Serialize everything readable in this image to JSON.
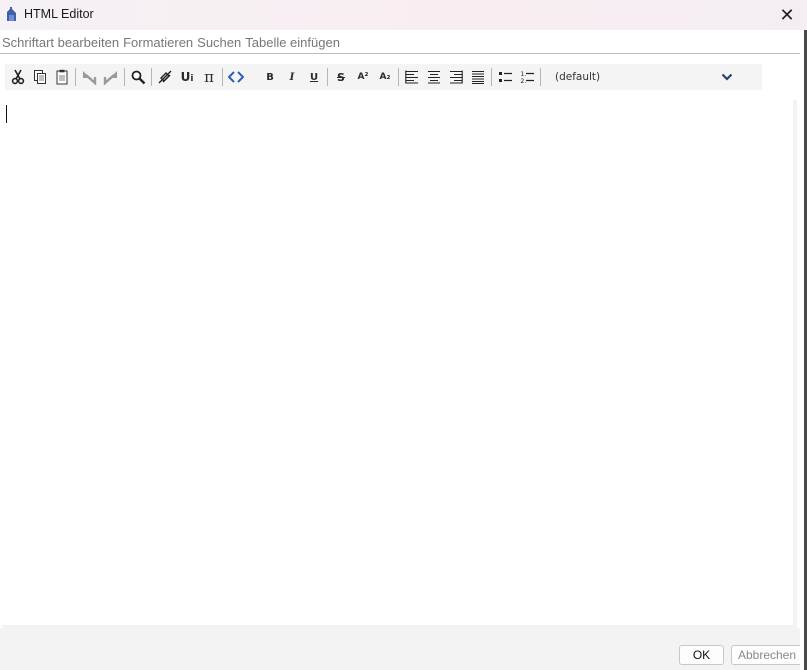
{
  "window": {
    "title": "HTML Editor",
    "close_glyph": "✕"
  },
  "menu": {
    "items": [
      "Schriftart bearbeiten",
      "Formatieren",
      "Suchen",
      "Tabelle einfügen"
    ]
  },
  "toolbar": {
    "font_select_value": "(default)",
    "bold_label": "B",
    "italic_label": "I",
    "underline_label": "U",
    "strike_label": "S",
    "superscript_label": "A²",
    "subscript_label": "A₂",
    "unicode_label": "U",
    "pi_label": "π"
  },
  "buttons": {
    "ok": "OK",
    "cancel": "Abbrechen"
  },
  "editor": {
    "content": ""
  },
  "colors": {
    "accent": "#2f5fb3",
    "disabled_text": "#8a8a8a"
  }
}
